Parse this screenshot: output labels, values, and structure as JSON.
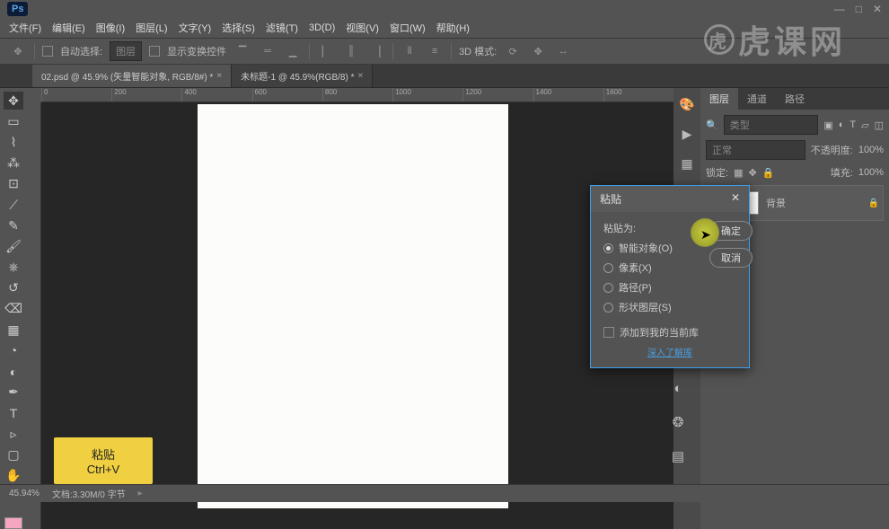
{
  "app": {
    "logo": "Ps"
  },
  "window_controls": {
    "min": "—",
    "max": "□",
    "close": "✕"
  },
  "menu": [
    "文件(F)",
    "编辑(E)",
    "图像(I)",
    "图层(L)",
    "文字(Y)",
    "选择(S)",
    "滤镜(T)",
    "3D(D)",
    "视图(V)",
    "窗口(W)",
    "帮助(H)"
  ],
  "options": {
    "auto_select": "自动选择:",
    "layer_dropdown": "图层",
    "show_transform": "显示变换控件",
    "mode3d": "3D 模式:"
  },
  "tabs": [
    {
      "label": "02.psd @ 45.9% (矢量智能对象, RGB/8#) *"
    },
    {
      "label": "未标题-1 @ 45.9%(RGB/8) *"
    }
  ],
  "ruler_ticks": [
    "0",
    "200",
    "400",
    "600",
    "800",
    "1000",
    "1200",
    "1400",
    "1600"
  ],
  "panels": {
    "tabs": [
      "图层",
      "通道",
      "路径"
    ],
    "search_placeholder": "类型",
    "blend_mode": "正常",
    "opacity_label": "不透明度:",
    "opacity_value": "100%",
    "lock_label": "锁定:",
    "fill_label": "填充:",
    "fill_value": "100%",
    "layer_name": "背景"
  },
  "paste_dialog": {
    "title": "粘贴",
    "close": "✕",
    "paste_as": "粘贴为:",
    "options": [
      "智能对象(O)",
      "像素(X)",
      "路径(P)",
      "形状图层(S)"
    ],
    "ok": "确定",
    "cancel": "取消",
    "add_to_lib": "添加到我的当前库",
    "learn_more": "深入了解库"
  },
  "tooltip": {
    "title": "粘贴",
    "shortcut": "Ctrl+V"
  },
  "status": {
    "zoom": "45.94%",
    "doc_info": "文档:3.30M/0 字节"
  },
  "watermark": {
    "text": "虎课网",
    "icon": "虎"
  }
}
